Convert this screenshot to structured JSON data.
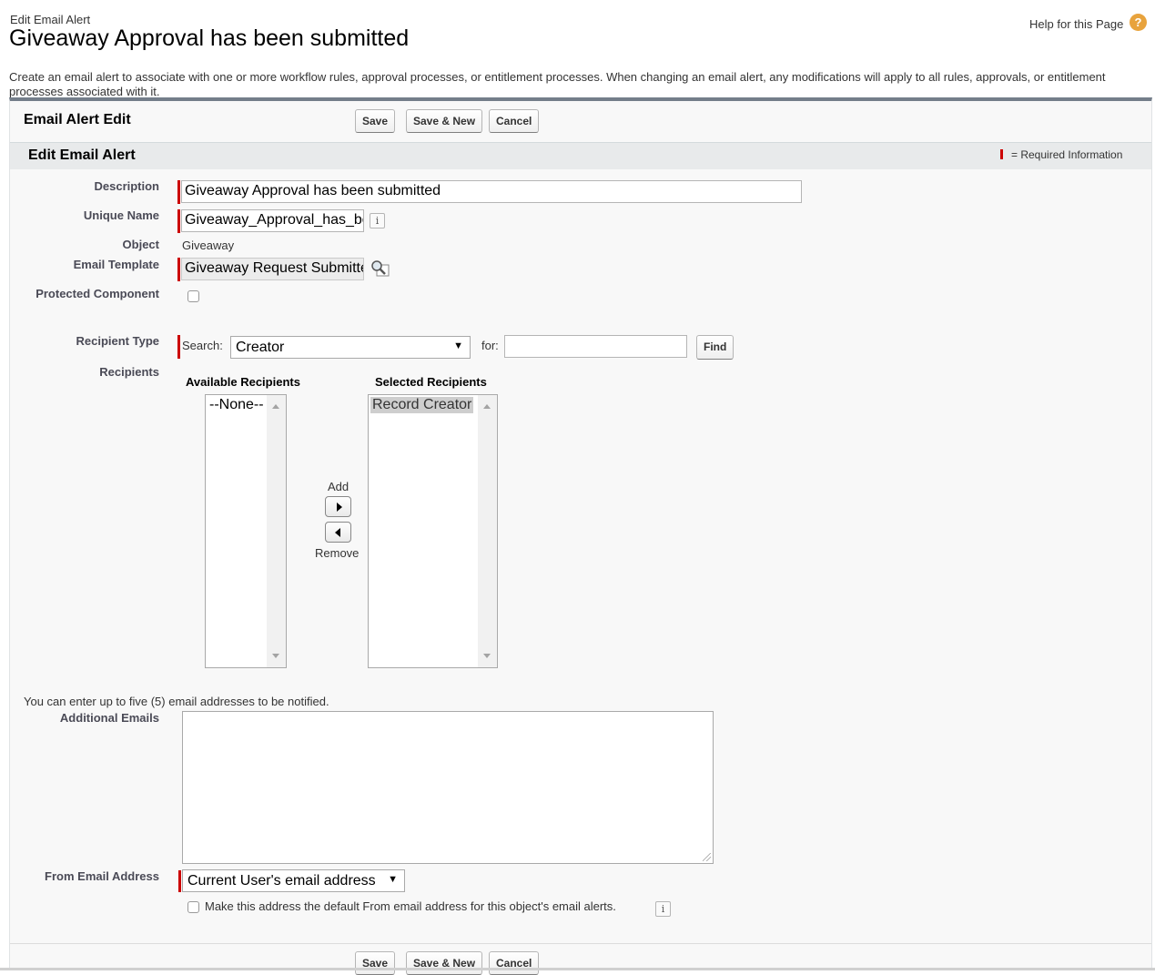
{
  "header": {
    "subtitle": "Edit Email Alert",
    "title": "Giveaway Approval has been submitted",
    "help_link": "Help for this Page",
    "help_icon": "?",
    "intro": "Create an email alert to associate with one or more workflow rules, approval processes, or entitlement processes. When changing an email alert, any modifications will apply to all rules, approvals, or entitlement processes associated with it."
  },
  "panel": {
    "title": "Email Alert Edit",
    "buttons": {
      "save": "Save",
      "save_new": "Save & New",
      "cancel": "Cancel"
    }
  },
  "section": {
    "title": "Edit Email Alert",
    "required_info": "= Required Information"
  },
  "form": {
    "description": {
      "label": "Description",
      "value": "Giveaway Approval has been submitted"
    },
    "unique_name": {
      "label": "Unique Name",
      "value": "Giveaway_Approval_has_been_submitted"
    },
    "object": {
      "label": "Object",
      "value": "Giveaway"
    },
    "email_template": {
      "label": "Email Template",
      "value": "Giveaway Request Submitted"
    },
    "protected_component": {
      "label": "Protected Component",
      "checked": false
    },
    "recipient_type": {
      "label": "Recipient Type",
      "search_label": "Search:",
      "search_value": "Creator",
      "for_label": "for:",
      "for_value": "",
      "find_button": "Find"
    },
    "recipients": {
      "label": "Recipients",
      "available_header": "Available Recipients",
      "available": [
        "--None--"
      ],
      "selected_header": "Selected Recipients",
      "selected": [
        "Record Creator"
      ],
      "add_label": "Add",
      "remove_label": "Remove"
    },
    "additional_emails": {
      "note": "You can enter up to five (5) email addresses to be notified.",
      "label": "Additional Emails",
      "value": ""
    },
    "from_email": {
      "label": "From Email Address",
      "value": "Current User's email address",
      "default_checkbox_label": "Make this address the default From email address for this object's email alerts.",
      "default_checked": false
    }
  },
  "info_icon": "i",
  "dropdown_arrow": "▼",
  "colors": {
    "required": "#cc0000",
    "help": "#e8a33d",
    "panel_border": "#747e8a"
  }
}
